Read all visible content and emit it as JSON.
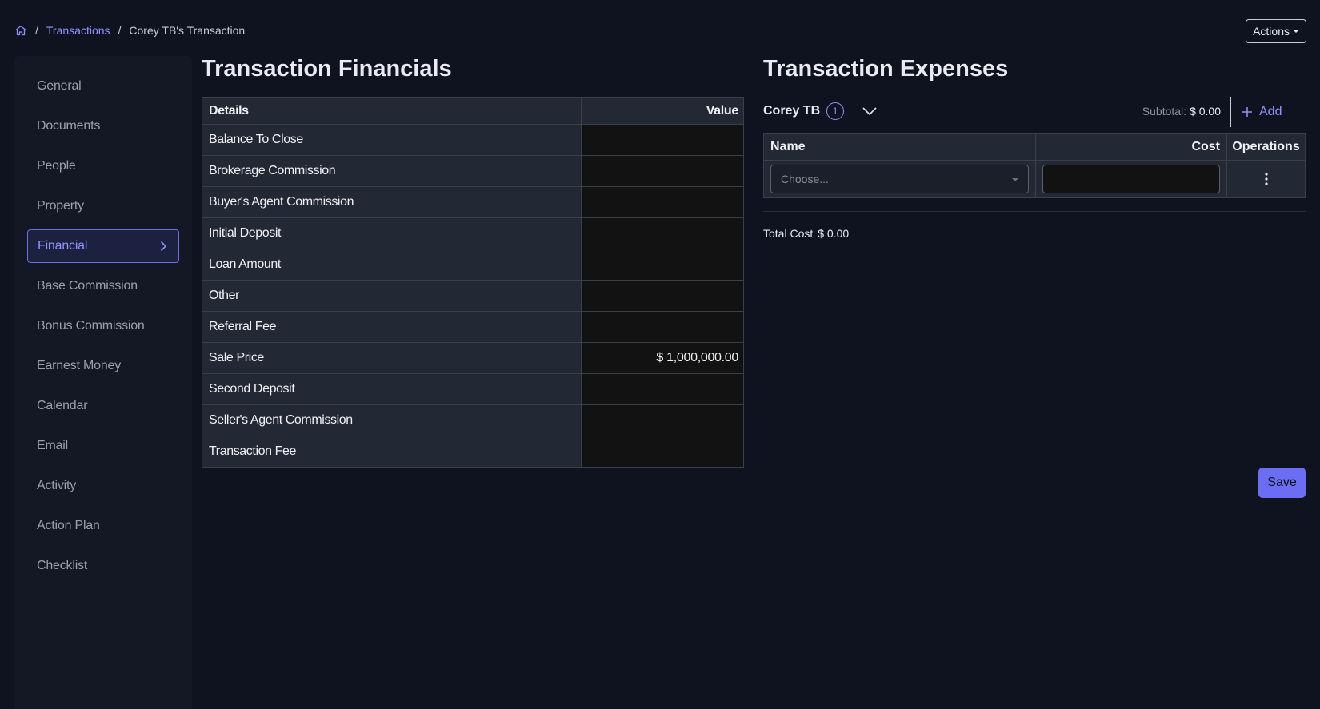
{
  "breadcrumb": {
    "home_icon": "home-icon",
    "link": "Transactions",
    "current": "Corey TB's Transaction",
    "separator": "/"
  },
  "actions_label": "Actions",
  "sidebar": {
    "items": [
      {
        "label": "General"
      },
      {
        "label": "Documents"
      },
      {
        "label": "People"
      },
      {
        "label": "Property"
      },
      {
        "label": "Financial",
        "active": true
      },
      {
        "label": "Base Commission"
      },
      {
        "label": "Bonus Commission"
      },
      {
        "label": "Earnest Money"
      },
      {
        "label": "Calendar"
      },
      {
        "label": "Email"
      },
      {
        "label": "Activity"
      },
      {
        "label": "Action Plan"
      },
      {
        "label": "Checklist"
      }
    ]
  },
  "financials": {
    "title": "Transaction Financials",
    "columns": [
      "Details",
      "Value"
    ],
    "rows": [
      {
        "detail": "Balance To Close",
        "value": ""
      },
      {
        "detail": "Brokerage Commission",
        "value": ""
      },
      {
        "detail": "Buyer's Agent Commission",
        "value": ""
      },
      {
        "detail": "Initial Deposit",
        "value": ""
      },
      {
        "detail": "Loan Amount",
        "value": ""
      },
      {
        "detail": "Other",
        "value": ""
      },
      {
        "detail": "Referral Fee",
        "value": ""
      },
      {
        "detail": "Sale Price",
        "value": "$ 1,000,000.00"
      },
      {
        "detail": "Second Deposit",
        "value": ""
      },
      {
        "detail": "Seller's Agent Commission",
        "value": ""
      },
      {
        "detail": "Transaction Fee",
        "value": ""
      }
    ]
  },
  "expenses": {
    "title": "Transaction Expenses",
    "owner": "Corey TB",
    "owner_count": "1",
    "subtotal_label": "Subtotal:",
    "subtotal_value": "$ 0.00",
    "add_label": "Add",
    "columns": [
      "Name",
      "Cost",
      "Operations"
    ],
    "name_placeholder": "Choose...",
    "cost_value": "",
    "total_label": "Total Cost",
    "total_value": "$ 0.00"
  },
  "save_label": "Save",
  "colors": {
    "accent": "#8f93ff",
    "background": "#0f1320",
    "save_button": "#6b6ef2"
  }
}
